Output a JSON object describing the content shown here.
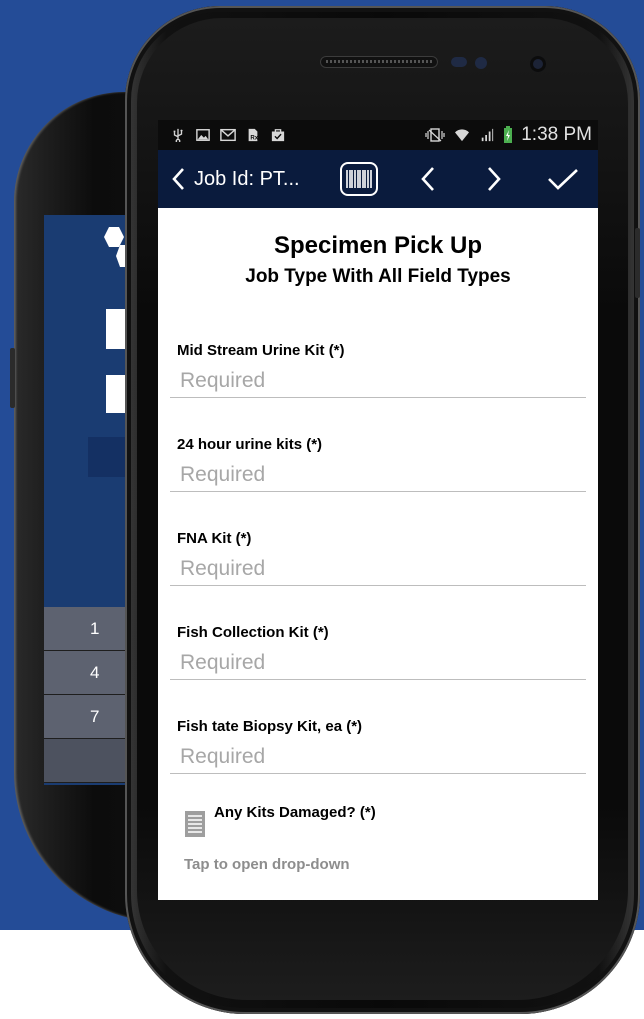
{
  "status_bar": {
    "time": "1:38 PM",
    "icons_left": [
      "usb-icon",
      "image-icon",
      "gmail-icon",
      "prescription-icon",
      "briefcase-check-icon"
    ],
    "icons_right": [
      "vibrate-icon",
      "wifi-icon",
      "signal-icon",
      "battery-charging-icon"
    ]
  },
  "action_bar": {
    "title": "Job Id: PT...",
    "buttons": [
      "back-chevron-icon",
      "barcode-icon",
      "previous-chevron-icon",
      "next-chevron-icon",
      "checkmark-icon"
    ]
  },
  "form": {
    "title": "Specimen Pick Up",
    "subtitle": "Job Type With All Field Types",
    "fields": [
      {
        "label": "Mid Stream Urine Kit (*)",
        "placeholder": "Required",
        "value": ""
      },
      {
        "label": "24 hour urine kits (*)",
        "placeholder": "Required",
        "value": ""
      },
      {
        "label": "FNA Kit (*)",
        "placeholder": "Required",
        "value": ""
      },
      {
        "label": "Fish Collection Kit (*)",
        "placeholder": "Required",
        "value": ""
      },
      {
        "label": "Fish tate Biopsy Kit, ea (*)",
        "placeholder": "Required",
        "value": ""
      }
    ],
    "dropdown": {
      "label": "Any Kits Damaged? (*)",
      "hint": "Tap to open drop-down"
    }
  },
  "back_phone": {
    "keypad_keys": [
      "1",
      "4",
      "7",
      ""
    ]
  },
  "colors": {
    "background_blue": "#244c97",
    "action_bar": "#0a1b3d",
    "status_bar": "#0c0c0c"
  }
}
